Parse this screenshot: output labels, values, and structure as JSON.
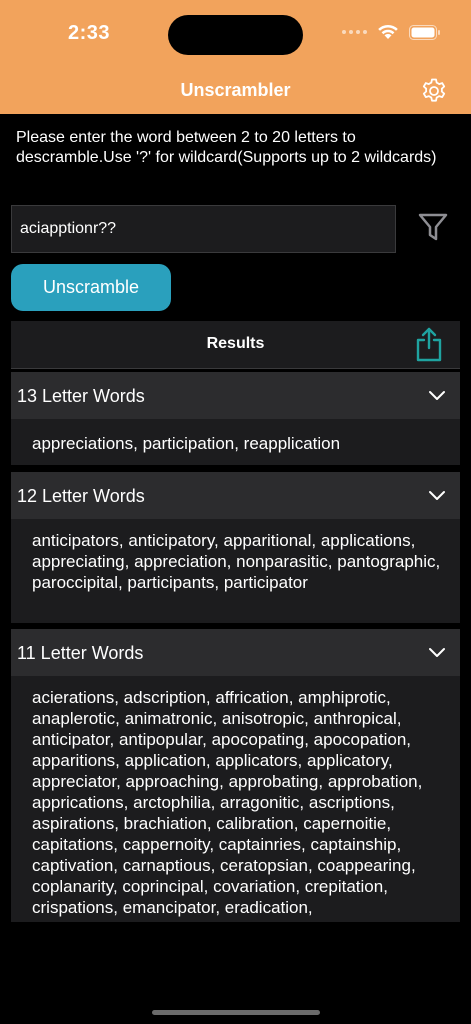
{
  "status_bar": {
    "time": "2:33"
  },
  "header": {
    "title": "Unscrambler"
  },
  "instructions": "Please enter the word between 2 to 20 letters to descramble.Use '?' for wildcard(Supports up to 2 wildcards)",
  "search": {
    "value": "aciapptionr??"
  },
  "unscramble_label": "Unscramble",
  "results": {
    "title": "Results"
  },
  "sections": [
    {
      "label": "13 Letter Words",
      "words": "appreciations, participation, reapplication"
    },
    {
      "label": "12 Letter Words",
      "words": "anticipators, anticipatory, apparitional, applications, appreciating, appreciation, nonparasitic, pantographic, paroccipital, participants, participator"
    },
    {
      "label": "11 Letter Words",
      "words": "acierations, adscription, affrication, amphiprotic, anaplerotic, animatronic, anisotropic, anthropical, anticipator, antipopular, apocopating, apocopation, apparitions, application, applicators, applicatory, appreciator, approaching, approbating, approbation, apprications, arctophilia, arragonitic, ascriptions, aspirations, brachiation, calibration, capernoitie, capitations, cappernoity, captainries, captainship, captivation, carnaptious, ceratopsian, coappearing, coplanarity, coprincipal, covariation, crepitation, crispations, emancipator, eradication,"
    }
  ],
  "colors": {
    "header": "#f2a35c",
    "button": "#2aa0bd",
    "share": "#1fa3a0"
  }
}
